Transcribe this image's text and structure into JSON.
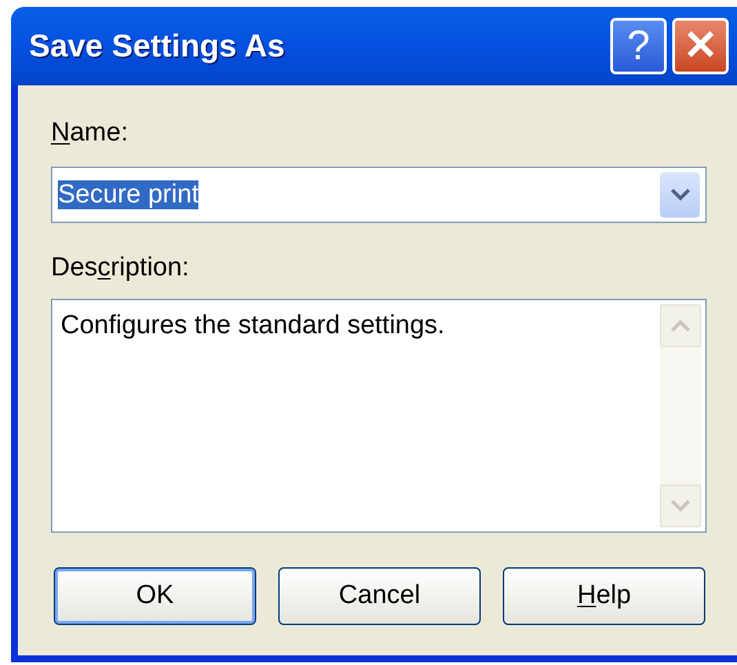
{
  "window": {
    "title": "Save Settings As"
  },
  "title_buttons": [
    {
      "kind": "help",
      "label": "?"
    },
    {
      "kind": "close",
      "label": "✕"
    }
  ],
  "name_field": {
    "label": {
      "key": "N",
      "after": "ame:"
    },
    "value": "Secure print",
    "text_selected": true
  },
  "description_field": {
    "label": {
      "before": "Des",
      "key": "c",
      "after": "ription:"
    },
    "value": "Configures the standard settings."
  },
  "buttons": [
    {
      "label": {
        "after": "OK"
      },
      "default": true
    },
    {
      "label": {
        "after": "Cancel"
      },
      "default": false
    },
    {
      "label": {
        "key": "H",
        "after": "elp"
      },
      "default": false
    }
  ]
}
